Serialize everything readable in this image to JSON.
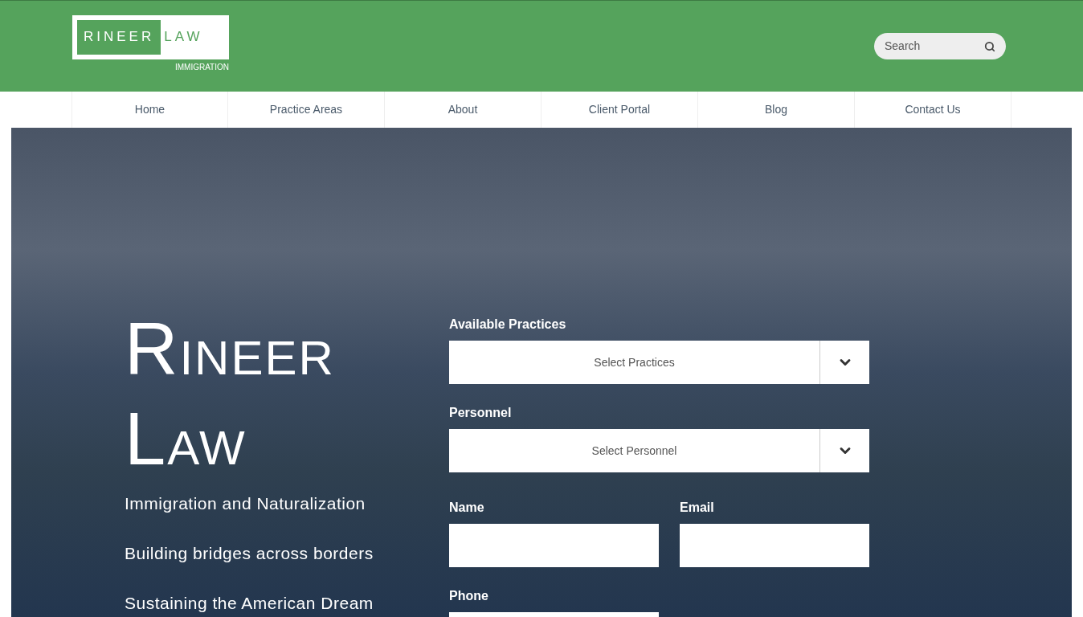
{
  "logo": {
    "left": "RINEER",
    "right": "LAW",
    "sub": "IMMIGRATION"
  },
  "search": {
    "placeholder": "Search"
  },
  "nav": [
    {
      "label": "Home"
    },
    {
      "label": "Practice Areas"
    },
    {
      "label": "About"
    },
    {
      "label": "Client Portal"
    },
    {
      "label": "Blog"
    },
    {
      "label": "Contact Us"
    }
  ],
  "hero": {
    "title_lines": [
      "RINEER",
      "LAW"
    ],
    "taglines": [
      "Immigration and Naturalization",
      "Building bridges across borders",
      "Sustaining the American Dream"
    ]
  },
  "form": {
    "fields": [
      {
        "kind": "select",
        "label": "Available Practices",
        "value": "Select Practices"
      },
      {
        "kind": "select",
        "label": "Personnel",
        "value": "Select Personnel"
      },
      {
        "kind": "pair",
        "items": [
          {
            "label": "Name"
          },
          {
            "label": "Email"
          }
        ]
      },
      {
        "kind": "text",
        "label": "Phone"
      }
    ]
  }
}
